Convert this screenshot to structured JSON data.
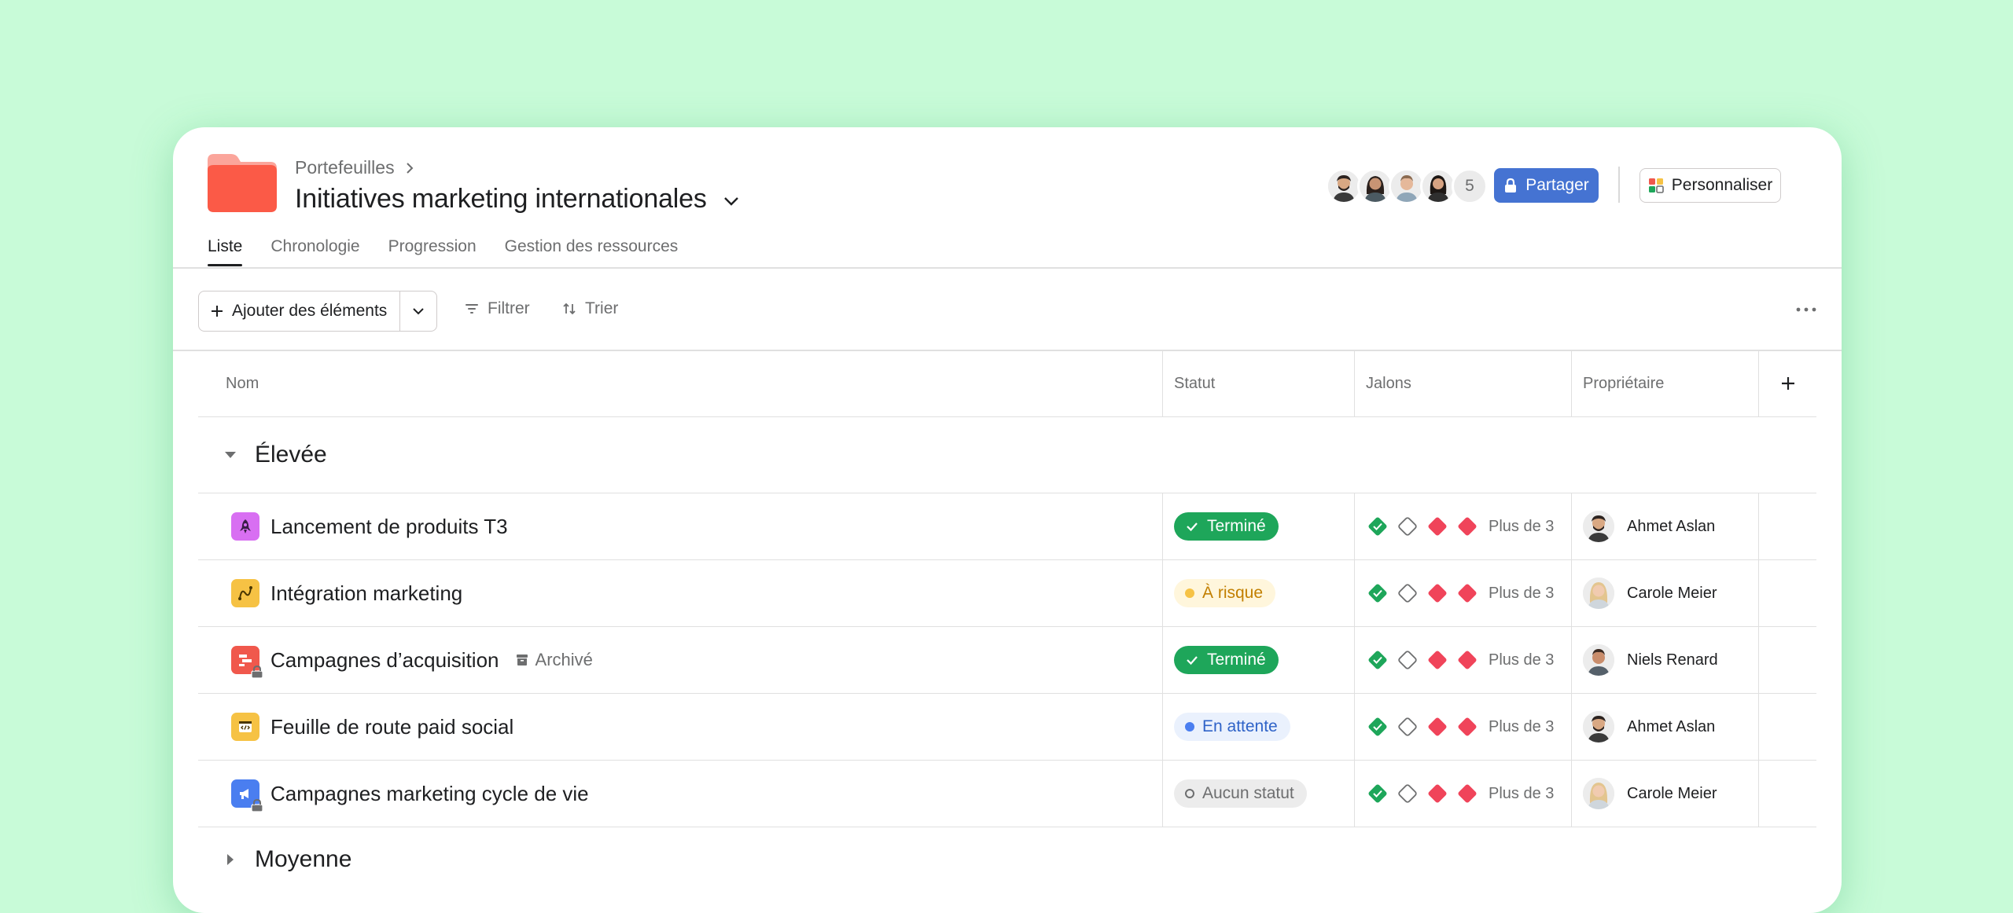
{
  "project": {
    "breadcrumb": "Portefeuilles",
    "title": "Initiatives marketing internationales",
    "folder_color": "#fb6a5a"
  },
  "header": {
    "members_extra": "5",
    "share_label": "Partager",
    "customize_label": "Personnaliser",
    "share_color": "#4573d2"
  },
  "tabs": [
    {
      "label": "Liste"
    },
    {
      "label": "Chronologie"
    },
    {
      "label": "Progression"
    },
    {
      "label": "Gestion des ressources"
    }
  ],
  "toolbar": {
    "add_label": "Ajouter des éléments",
    "filter_label": "Filtrer",
    "sort_label": "Trier"
  },
  "table": {
    "columns": [
      "Nom",
      "Statut",
      "Jalons",
      "Propriétaire"
    ],
    "sections": [
      {
        "title": "Élevée",
        "rows": [
          {
            "name": "Lancement de produits T3",
            "icon": "rocket-icon",
            "icon_color": "#d86ff2",
            "status": "Terminé",
            "milestones_more": "Plus de 3",
            "owner": "Ahmet Aslan",
            "archived": ""
          },
          {
            "name": "Intégration marketing",
            "icon": "curve-icon",
            "icon_color": "#f6c244",
            "status": "À risque",
            "milestones_more": "Plus de 3",
            "owner": "Carole Meier",
            "archived": ""
          },
          {
            "name": "Campagnes d’acquisition",
            "icon": "gantt-icon",
            "icon_color": "#f0584c",
            "status": "Terminé",
            "milestones_more": "Plus de 3",
            "owner": "Niels Renard",
            "archived": "Archivé"
          },
          {
            "name": "Feuille de route paid social",
            "icon": "code-icon",
            "icon_color": "#f6c244",
            "status": "En attente",
            "milestones_more": "Plus de 3",
            "owner": "Ahmet Aslan",
            "archived": ""
          },
          {
            "name": "Campagnes marketing cycle de vie",
            "icon": "megaphone-icon",
            "icon_color": "#4a7ef0",
            "status": "Aucun statut",
            "milestones_more": "Plus de 3",
            "owner": "Carole Meier",
            "archived": ""
          }
        ]
      },
      {
        "title": "Moyenne"
      }
    ]
  }
}
